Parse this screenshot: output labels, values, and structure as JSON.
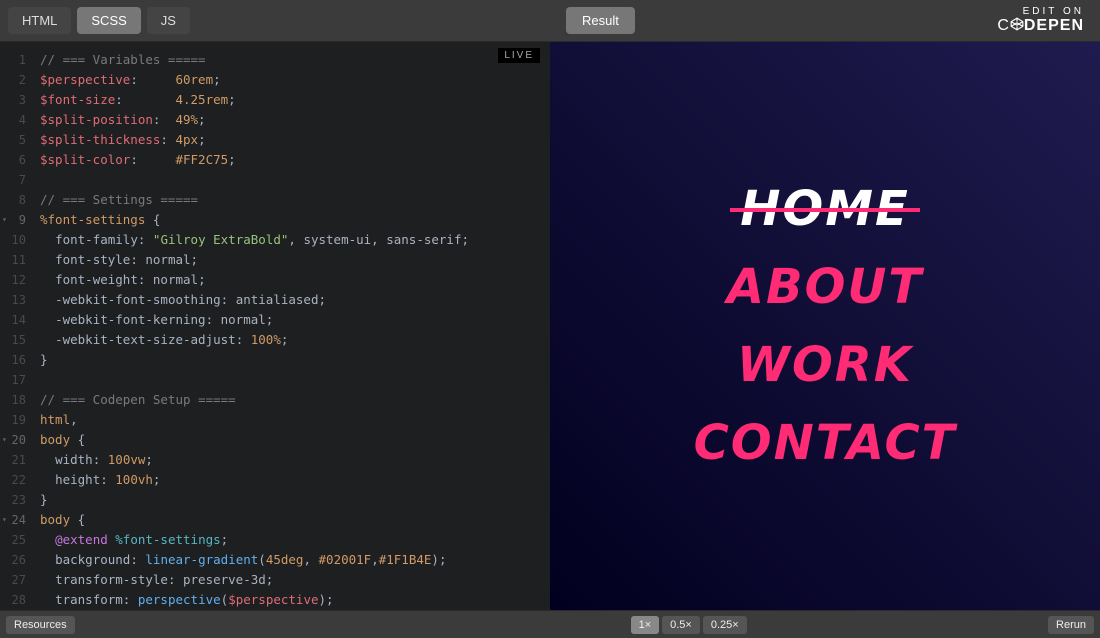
{
  "topbar": {
    "tabs": {
      "html": "HTML",
      "scss": "SCSS",
      "js": "JS"
    },
    "result": "Result",
    "brand_top": "EDIT ON",
    "brand_name_a": "C",
    "brand_name_b": "DEPEN"
  },
  "editor": {
    "live": "LIVE",
    "lines": [
      {
        "n": "1",
        "frag": [
          {
            "cls": "c-comment",
            "t": "// === Variables ====="
          }
        ]
      },
      {
        "n": "2",
        "frag": [
          {
            "cls": "c-var",
            "t": "$perspective"
          },
          {
            "cls": "c-punct",
            "t": ":     "
          },
          {
            "cls": "c-num",
            "t": "60rem"
          },
          {
            "cls": "c-punct",
            "t": ";"
          }
        ]
      },
      {
        "n": "3",
        "frag": [
          {
            "cls": "c-var",
            "t": "$font-size"
          },
          {
            "cls": "c-punct",
            "t": ":       "
          },
          {
            "cls": "c-num",
            "t": "4.25rem"
          },
          {
            "cls": "c-punct",
            "t": ";"
          }
        ]
      },
      {
        "n": "4",
        "frag": [
          {
            "cls": "c-var",
            "t": "$split-position"
          },
          {
            "cls": "c-punct",
            "t": ":  "
          },
          {
            "cls": "c-num",
            "t": "49%"
          },
          {
            "cls": "c-punct",
            "t": ";"
          }
        ]
      },
      {
        "n": "5",
        "frag": [
          {
            "cls": "c-var",
            "t": "$split-thickness"
          },
          {
            "cls": "c-punct",
            "t": ": "
          },
          {
            "cls": "c-num",
            "t": "4px"
          },
          {
            "cls": "c-punct",
            "t": ";"
          }
        ]
      },
      {
        "n": "6",
        "frag": [
          {
            "cls": "c-var",
            "t": "$split-color"
          },
          {
            "cls": "c-punct",
            "t": ":     "
          },
          {
            "cls": "c-num",
            "t": "#FF2C75"
          },
          {
            "cls": "c-punct",
            "t": ";"
          }
        ]
      },
      {
        "n": "7",
        "frag": []
      },
      {
        "n": "8",
        "frag": [
          {
            "cls": "c-comment",
            "t": "// === Settings ====="
          }
        ]
      },
      {
        "n": "9",
        "fold": true,
        "frag": [
          {
            "cls": "c-sel",
            "t": "%font-settings"
          },
          {
            "cls": "c-punct",
            "t": " {"
          }
        ]
      },
      {
        "n": "10",
        "frag": [
          {
            "cls": "",
            "t": "  "
          },
          {
            "cls": "c-prop",
            "t": "font-family"
          },
          {
            "cls": "c-punct",
            "t": ": "
          },
          {
            "cls": "c-str",
            "t": "\"Gilroy ExtraBold\""
          },
          {
            "cls": "c-punct",
            "t": ", system-ui, sans-serif;"
          }
        ]
      },
      {
        "n": "11",
        "frag": [
          {
            "cls": "",
            "t": "  "
          },
          {
            "cls": "c-prop",
            "t": "font-style"
          },
          {
            "cls": "c-punct",
            "t": ": normal;"
          }
        ]
      },
      {
        "n": "12",
        "frag": [
          {
            "cls": "",
            "t": "  "
          },
          {
            "cls": "c-prop",
            "t": "font-weight"
          },
          {
            "cls": "c-punct",
            "t": ": normal;"
          }
        ]
      },
      {
        "n": "13",
        "frag": [
          {
            "cls": "",
            "t": "  "
          },
          {
            "cls": "c-prop",
            "t": "-webkit-font-smoothing"
          },
          {
            "cls": "c-punct",
            "t": ": antialiased;"
          }
        ]
      },
      {
        "n": "14",
        "frag": [
          {
            "cls": "",
            "t": "  "
          },
          {
            "cls": "c-prop",
            "t": "-webkit-font-kerning"
          },
          {
            "cls": "c-punct",
            "t": ": normal;"
          }
        ]
      },
      {
        "n": "15",
        "frag": [
          {
            "cls": "",
            "t": "  "
          },
          {
            "cls": "c-prop",
            "t": "-webkit-text-size-adjust"
          },
          {
            "cls": "c-punct",
            "t": ": "
          },
          {
            "cls": "c-num",
            "t": "100%"
          },
          {
            "cls": "c-punct",
            "t": ";"
          }
        ]
      },
      {
        "n": "16",
        "frag": [
          {
            "cls": "c-punct",
            "t": "}"
          }
        ]
      },
      {
        "n": "17",
        "frag": []
      },
      {
        "n": "18",
        "frag": [
          {
            "cls": "c-comment",
            "t": "// === Codepen Setup ====="
          }
        ]
      },
      {
        "n": "19",
        "frag": [
          {
            "cls": "c-sel",
            "t": "html"
          },
          {
            "cls": "c-punct",
            "t": ","
          }
        ]
      },
      {
        "n": "20",
        "fold": true,
        "frag": [
          {
            "cls": "c-sel",
            "t": "body"
          },
          {
            "cls": "c-punct",
            "t": " {"
          }
        ]
      },
      {
        "n": "21",
        "frag": [
          {
            "cls": "",
            "t": "  "
          },
          {
            "cls": "c-prop",
            "t": "width"
          },
          {
            "cls": "c-punct",
            "t": ": "
          },
          {
            "cls": "c-num",
            "t": "100vw"
          },
          {
            "cls": "c-punct",
            "t": ";"
          }
        ]
      },
      {
        "n": "22",
        "frag": [
          {
            "cls": "",
            "t": "  "
          },
          {
            "cls": "c-prop",
            "t": "height"
          },
          {
            "cls": "c-punct",
            "t": ": "
          },
          {
            "cls": "c-num",
            "t": "100vh"
          },
          {
            "cls": "c-punct",
            "t": ";"
          }
        ]
      },
      {
        "n": "23",
        "frag": [
          {
            "cls": "c-punct",
            "t": "}"
          }
        ]
      },
      {
        "n": "24",
        "fold": true,
        "frag": [
          {
            "cls": "c-sel",
            "t": "body"
          },
          {
            "cls": "c-punct",
            "t": " {"
          }
        ]
      },
      {
        "n": "25",
        "frag": [
          {
            "cls": "",
            "t": "  "
          },
          {
            "cls": "c-key",
            "t": "@extend"
          },
          {
            "cls": "c-punct",
            "t": " "
          },
          {
            "cls": "c-ext",
            "t": "%font-settings"
          },
          {
            "cls": "c-punct",
            "t": ";"
          }
        ]
      },
      {
        "n": "26",
        "frag": [
          {
            "cls": "",
            "t": "  "
          },
          {
            "cls": "c-prop",
            "t": "background"
          },
          {
            "cls": "c-punct",
            "t": ": "
          },
          {
            "cls": "c-func",
            "t": "linear-gradient"
          },
          {
            "cls": "c-punct",
            "t": "("
          },
          {
            "cls": "c-num",
            "t": "45deg"
          },
          {
            "cls": "c-punct",
            "t": ", "
          },
          {
            "cls": "c-num",
            "t": "#02001F"
          },
          {
            "cls": "c-punct",
            "t": ","
          },
          {
            "cls": "c-num",
            "t": "#1F1B4E"
          },
          {
            "cls": "c-punct",
            "t": ");"
          }
        ]
      },
      {
        "n": "27",
        "frag": [
          {
            "cls": "",
            "t": "  "
          },
          {
            "cls": "c-prop",
            "t": "transform-style"
          },
          {
            "cls": "c-punct",
            "t": ": preserve-3d;"
          }
        ]
      },
      {
        "n": "28",
        "frag": [
          {
            "cls": "",
            "t": "  "
          },
          {
            "cls": "c-prop",
            "t": "transform"
          },
          {
            "cls": "c-punct",
            "t": ": "
          },
          {
            "cls": "c-func",
            "t": "perspective"
          },
          {
            "cls": "c-punct",
            "t": "("
          },
          {
            "cls": "c-var",
            "t": "$perspective"
          },
          {
            "cls": "c-punct",
            "t": ");"
          }
        ]
      }
    ]
  },
  "preview": {
    "items": [
      "HOME",
      "ABOUT",
      "WORK",
      "CONTACT"
    ]
  },
  "bottombar": {
    "resources": "Resources",
    "zoom": [
      "1×",
      "0.5×",
      "0.25×"
    ],
    "rerun": "Rerun"
  }
}
